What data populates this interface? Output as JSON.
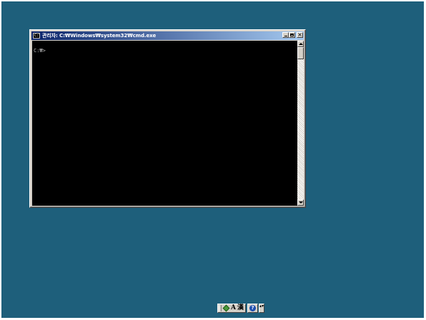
{
  "window": {
    "icon_text": "C:\\",
    "title": "관리자: C:₩Windows₩system32₩cmd.exe",
    "buttons": {
      "minimize": "minimize",
      "maximize": "maximize",
      "close": "×"
    }
  },
  "console": {
    "prompt": "C:₩>"
  },
  "ime_bar": {
    "mode_letter": "A",
    "hanja_glyph": "漢",
    "help_glyph": "?",
    "more_glyph": "▴▾"
  },
  "colors": {
    "desktop": "#1e5f7b",
    "console_bg": "#000000",
    "console_text": "#c0c0c0",
    "titlebar_start": "#0a246a",
    "titlebar_end": "#a6caf0"
  }
}
